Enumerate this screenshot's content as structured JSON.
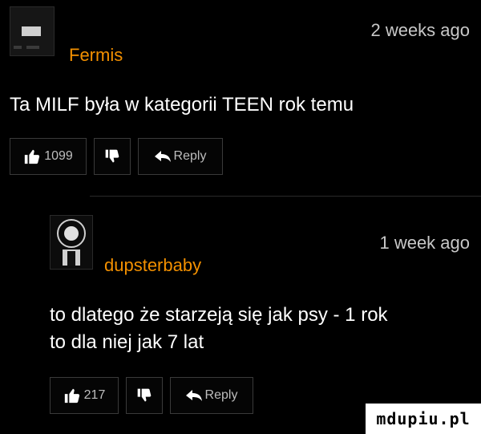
{
  "comments": [
    {
      "username": "Fermis",
      "time": "2 weeks ago",
      "text": [
        "Ta MILF była w kategorii TEEN rok temu"
      ],
      "likes": "1099",
      "reply_label": "Reply"
    },
    {
      "username": "dupsterbaby",
      "time": "1 week ago",
      "text": [
        "to dlatego że starzeją się jak psy - 1 rok",
        "to dla niej jak 7 lat"
      ],
      "likes": "217",
      "reply_label": "Reply"
    }
  ],
  "watermark": "mdupiu.pl",
  "colors": {
    "username": "#f39000",
    "background": "#000000"
  },
  "icons": [
    "thumbs-up-icon",
    "thumbs-down-icon",
    "reply-arrow-icon"
  ]
}
